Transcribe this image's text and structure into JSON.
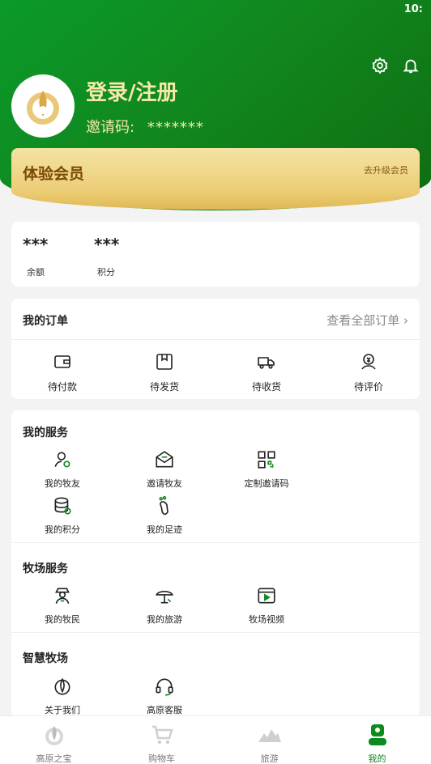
{
  "status": {
    "time": "10:"
  },
  "profile": {
    "login_text": "登录/注册",
    "invite_label": "邀请码:",
    "invite_code": "*******"
  },
  "vip": {
    "title": "体验会员",
    "upgrade": "去升级会员"
  },
  "balance": {
    "items": [
      {
        "value": "***",
        "label": "余额"
      },
      {
        "value": "***",
        "label": "积分"
      }
    ]
  },
  "orders": {
    "title": "我的订单",
    "view_all": "查看全部订单",
    "items": [
      {
        "label": "待付款",
        "icon": "wallet-icon"
      },
      {
        "label": "待发货",
        "icon": "package-icon"
      },
      {
        "label": "待收货",
        "icon": "truck-icon"
      },
      {
        "label": "待评价",
        "icon": "review-icon"
      }
    ]
  },
  "my_services": {
    "title": "我的服务",
    "items": [
      {
        "label": "我的牧友",
        "icon": "friend-icon"
      },
      {
        "label": "邀请牧友",
        "icon": "invite-icon"
      },
      {
        "label": "定制邀请码",
        "icon": "qr-code-icon"
      },
      {
        "label": "我的积分",
        "icon": "points-icon"
      },
      {
        "label": "我的足迹",
        "icon": "footprint-icon"
      }
    ]
  },
  "ranch_services": {
    "title": "牧场服务",
    "items": [
      {
        "label": "我的牧民",
        "icon": "herder-icon"
      },
      {
        "label": "我的旅游",
        "icon": "travel-icon"
      },
      {
        "label": "牧场视频",
        "icon": "video-icon"
      }
    ]
  },
  "smart_ranch": {
    "title": "智慧牧场",
    "items": [
      {
        "label": "关于我们",
        "icon": "about-icon"
      },
      {
        "label": "高原客服",
        "icon": "headset-icon"
      }
    ]
  },
  "tabbar": {
    "items": [
      {
        "label": "高原之宝",
        "icon": "home-logo-icon"
      },
      {
        "label": "购物车",
        "icon": "cart-icon"
      },
      {
        "label": "旅游",
        "icon": "mountain-icon"
      },
      {
        "label": "我的",
        "icon": "profile-icon"
      }
    ]
  },
  "colors": {
    "brand_green": "#0d8a1e",
    "gold": "#eccd76",
    "gold_text": "#f7e9a8"
  }
}
